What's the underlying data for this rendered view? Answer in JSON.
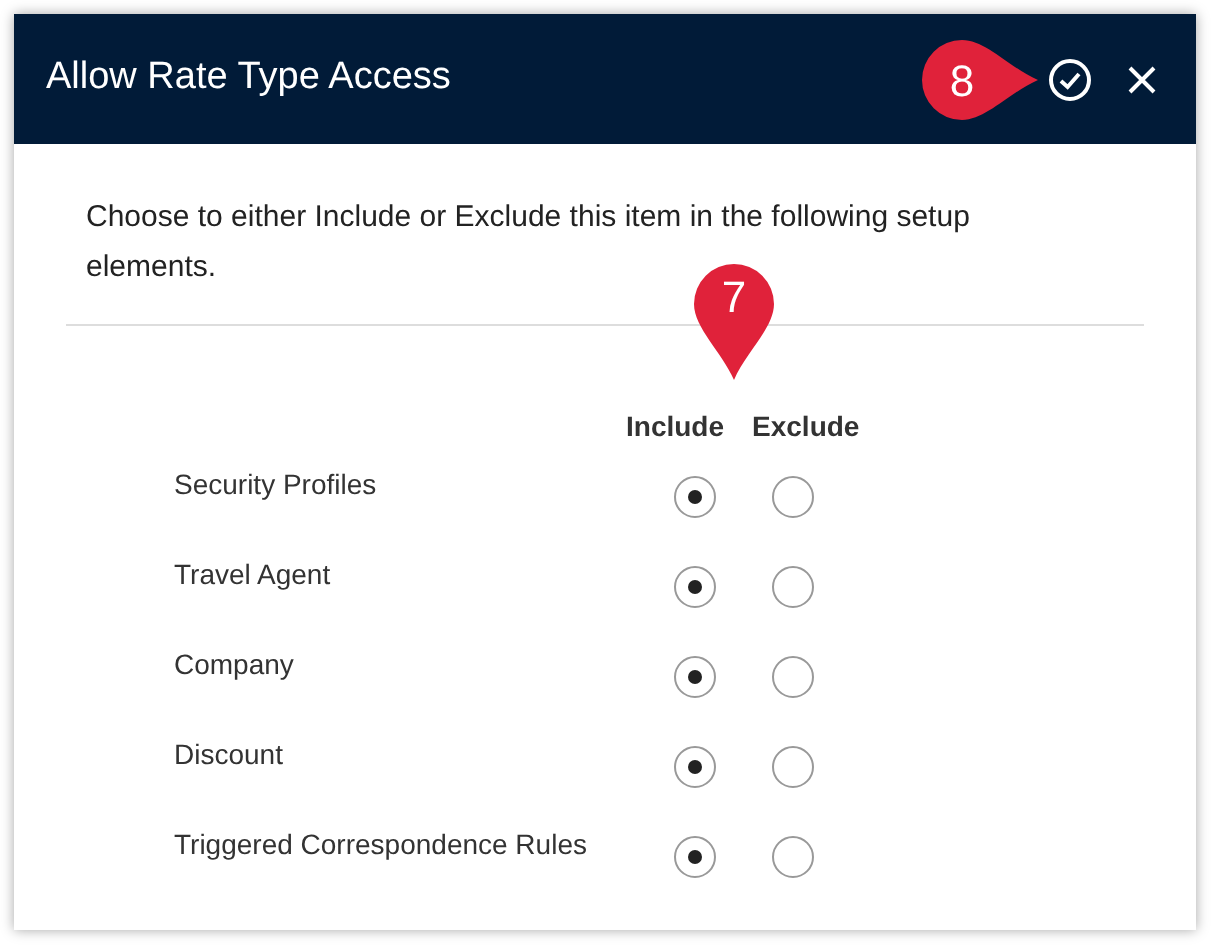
{
  "dialog": {
    "title": "Allow Rate Type Access",
    "actions": [
      {
        "kind": "confirm"
      },
      {
        "kind": "close"
      }
    ],
    "description": "Choose to either Include or Exclude this item in the following setup elements.",
    "columns": [
      "Include",
      "Exclude"
    ],
    "rows": [
      {
        "label": "Security Profiles",
        "options": [
          {
            "selected": true
          },
          {
            "selected": false
          }
        ]
      },
      {
        "label": "Travel Agent",
        "options": [
          {
            "selected": true
          },
          {
            "selected": false
          }
        ]
      },
      {
        "label": "Company",
        "options": [
          {
            "selected": true
          },
          {
            "selected": false
          }
        ]
      },
      {
        "label": "Discount",
        "options": [
          {
            "selected": true
          },
          {
            "selected": false
          }
        ]
      },
      {
        "label": "Triggered Correspondence Rules",
        "options": [
          {
            "selected": true
          },
          {
            "selected": false
          }
        ]
      }
    ]
  },
  "callouts": [
    {
      "number": "8",
      "kind": "point-right"
    },
    {
      "number": "7",
      "kind": "point-down"
    }
  ]
}
